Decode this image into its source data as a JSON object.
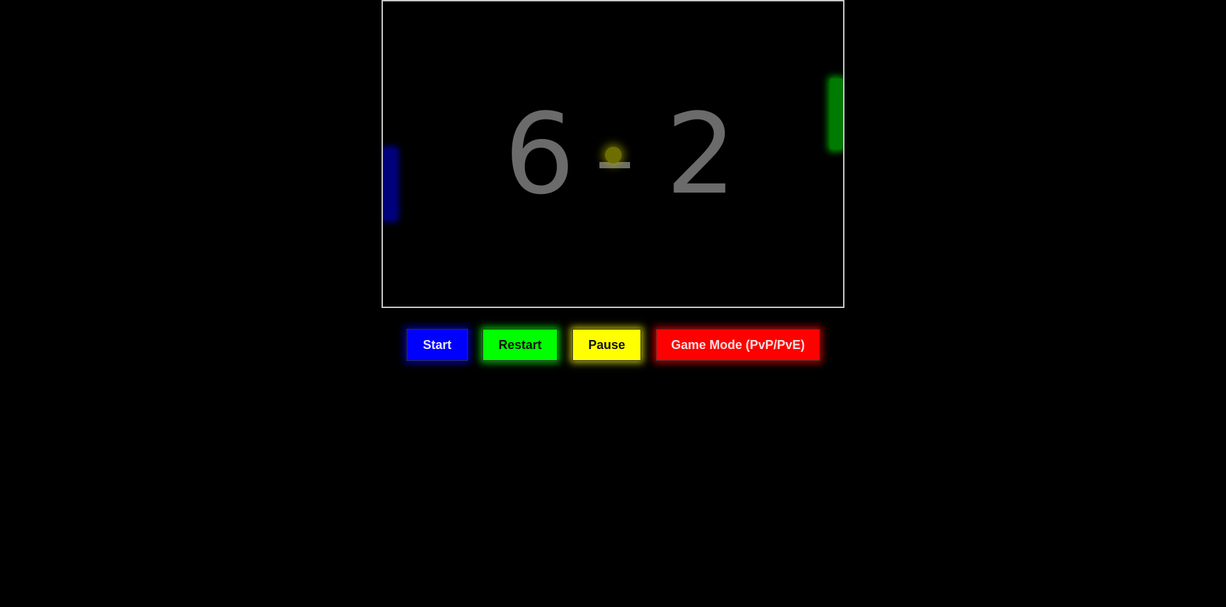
{
  "game": {
    "score_left": "6",
    "score_right": "2",
    "colors": {
      "left_paddle": "#0000ff",
      "right_paddle": "#00ff00",
      "ball": "#ffff00",
      "score_text": "#6b6b6b",
      "border": "#c8c8c8",
      "background": "#000000"
    }
  },
  "controls": {
    "start_label": "Start",
    "restart_label": "Restart",
    "pause_label": "Pause",
    "mode_label": "Game Mode (PvP/PvE)"
  }
}
